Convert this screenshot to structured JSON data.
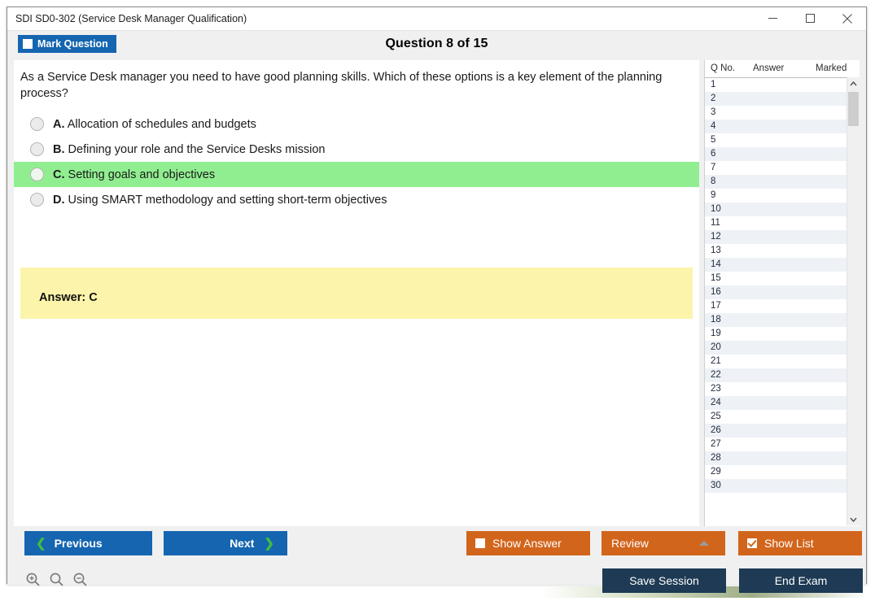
{
  "window": {
    "title": "SDI SD0-302 (Service Desk Manager Qualification)",
    "minimize_icon": "minimize-icon",
    "maximize_icon": "maximize-icon",
    "close_icon": "close-icon"
  },
  "header": {
    "mark_question_label": "Mark Question",
    "mark_question_checked": false,
    "question_counter": "Question 8 of 15"
  },
  "question": {
    "text": "As a Service Desk manager you need to have good planning skills. Which of these options is a key element of the planning process?",
    "options": [
      {
        "letter": "A.",
        "text": "Allocation of schedules and budgets",
        "correct": false
      },
      {
        "letter": "B.",
        "text": "Defining your role and the Service Desks mission",
        "correct": false
      },
      {
        "letter": "C.",
        "text": "Setting goals and objectives",
        "correct": true
      },
      {
        "letter": "D.",
        "text": "Using SMART methodology and setting short-term objectives",
        "correct": false
      }
    ],
    "answer_label": "Answer: C"
  },
  "list_panel": {
    "columns": [
      "Q No.",
      "Answer",
      "Marked"
    ],
    "rows": [
      {
        "no": "1",
        "answer": "",
        "marked": ""
      },
      {
        "no": "2",
        "answer": "",
        "marked": ""
      },
      {
        "no": "3",
        "answer": "",
        "marked": ""
      },
      {
        "no": "4",
        "answer": "",
        "marked": ""
      },
      {
        "no": "5",
        "answer": "",
        "marked": ""
      },
      {
        "no": "6",
        "answer": "",
        "marked": ""
      },
      {
        "no": "7",
        "answer": "",
        "marked": ""
      },
      {
        "no": "8",
        "answer": "",
        "marked": ""
      },
      {
        "no": "9",
        "answer": "",
        "marked": ""
      },
      {
        "no": "10",
        "answer": "",
        "marked": ""
      },
      {
        "no": "11",
        "answer": "",
        "marked": ""
      },
      {
        "no": "12",
        "answer": "",
        "marked": ""
      },
      {
        "no": "13",
        "answer": "",
        "marked": ""
      },
      {
        "no": "14",
        "answer": "",
        "marked": ""
      },
      {
        "no": "15",
        "answer": "",
        "marked": ""
      },
      {
        "no": "16",
        "answer": "",
        "marked": ""
      },
      {
        "no": "17",
        "answer": "",
        "marked": ""
      },
      {
        "no": "18",
        "answer": "",
        "marked": ""
      },
      {
        "no": "19",
        "answer": "",
        "marked": ""
      },
      {
        "no": "20",
        "answer": "",
        "marked": ""
      },
      {
        "no": "21",
        "answer": "",
        "marked": ""
      },
      {
        "no": "22",
        "answer": "",
        "marked": ""
      },
      {
        "no": "23",
        "answer": "",
        "marked": ""
      },
      {
        "no": "24",
        "answer": "",
        "marked": ""
      },
      {
        "no": "25",
        "answer": "",
        "marked": ""
      },
      {
        "no": "26",
        "answer": "",
        "marked": ""
      },
      {
        "no": "27",
        "answer": "",
        "marked": ""
      },
      {
        "no": "28",
        "answer": "",
        "marked": ""
      },
      {
        "no": "29",
        "answer": "",
        "marked": ""
      },
      {
        "no": "30",
        "answer": "",
        "marked": ""
      }
    ],
    "scroll_up_icon": "chevron-up-icon",
    "scroll_down_icon": "chevron-down-icon"
  },
  "actions": {
    "previous_label": "Previous",
    "next_label": "Next",
    "show_answer_label": "Show Answer",
    "show_answer_checked": false,
    "review_label": "Review",
    "show_list_label": "Show List",
    "show_list_checked": true,
    "save_session_label": "Save Session",
    "end_exam_label": "End Exam"
  },
  "zoom_tools": {
    "zoom_in_icon": "zoom-in-icon",
    "zoom_reset_icon": "zoom-reset-icon",
    "zoom_out_icon": "zoom-out-icon"
  },
  "colors": {
    "primary_blue": "#1565b0",
    "orange": "#d2651c",
    "navy": "#1e3a54",
    "correct_green": "#90ee90",
    "answer_yellow": "#fcf4ab",
    "chevron_green": "#3fbf3f"
  }
}
